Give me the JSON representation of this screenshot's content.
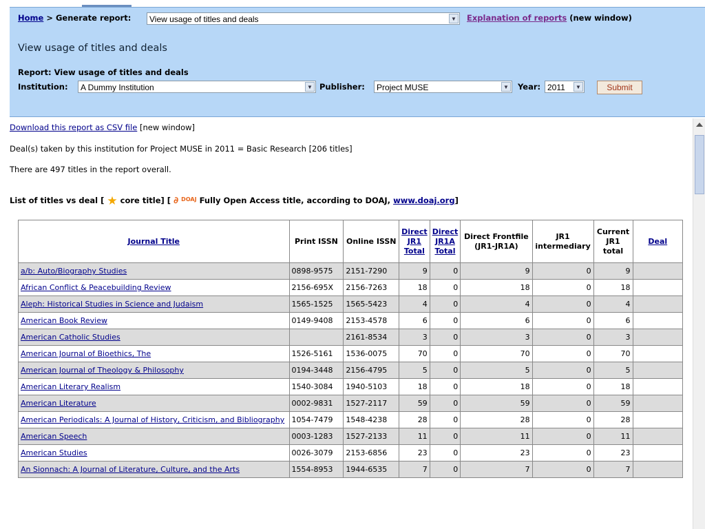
{
  "breadcrumb": {
    "home": "Home",
    "sep": ">",
    "label": "Generate report:",
    "report_select": "View usage of titles and deals",
    "explanation_link": "Explanation of reports",
    "explanation_suffix": "(new window)"
  },
  "panel": {
    "title": "View usage of titles and deals",
    "report_label": "Report:",
    "report_value": "View usage of titles and deals",
    "institution_label": "Institution:",
    "institution_value": "A Dummy Institution",
    "publisher_label": "Publisher:",
    "publisher_value": "Project MUSE",
    "year_label": "Year:",
    "year_value": "2011",
    "submit_label": "Submit"
  },
  "content": {
    "download_link": "Download this report as CSV file",
    "download_suffix": "[new window]",
    "deal_line": "Deal(s) taken by this institution for Project MUSE in 2011 = Basic Research [206 titles]",
    "count_line": "There are 497 titles in the report overall.",
    "list_head_pre": "List of titles vs deal [",
    "core_label": "core title] [",
    "doaj_badge": "DOAJ",
    "oa_label": "Fully Open Access title, according to DOAJ,",
    "doaj_link": "www.doaj.org",
    "list_head_post": "]"
  },
  "table": {
    "headers": {
      "title": "Journal Title",
      "print": "Print ISSN",
      "online": "Online ISSN",
      "jr1": "Direct JR1 Total",
      "jr1a": "Direct JR1A Total",
      "frontfile": "Direct Frontfile (JR1-JR1A)",
      "intermediary": "JR1 intermediary",
      "current": "Current JR1 total",
      "deal": "Deal"
    },
    "rows": [
      {
        "title": "a/b: Auto/Biography Studies",
        "print": "0898-9575",
        "online": "2151-7290",
        "jr1": "9",
        "jr1a": "0",
        "front": "9",
        "inter": "0",
        "cur": "9",
        "deal": ""
      },
      {
        "title": "African Conflict & Peacebuilding Review",
        "print": "2156-695X",
        "online": "2156-7263",
        "jr1": "18",
        "jr1a": "0",
        "front": "18",
        "inter": "0",
        "cur": "18",
        "deal": ""
      },
      {
        "title": "Aleph: Historical Studies in Science and Judaism",
        "print": "1565-1525",
        "online": "1565-5423",
        "jr1": "4",
        "jr1a": "0",
        "front": "4",
        "inter": "0",
        "cur": "4",
        "deal": ""
      },
      {
        "title": "American Book Review",
        "print": "0149-9408",
        "online": "2153-4578",
        "jr1": "6",
        "jr1a": "0",
        "front": "6",
        "inter": "0",
        "cur": "6",
        "deal": ""
      },
      {
        "title": "American Catholic Studies",
        "print": "",
        "online": "2161-8534",
        "jr1": "3",
        "jr1a": "0",
        "front": "3",
        "inter": "0",
        "cur": "3",
        "deal": ""
      },
      {
        "title": "American Journal of Bioethics, The",
        "print": "1526-5161",
        "online": "1536-0075",
        "jr1": "70",
        "jr1a": "0",
        "front": "70",
        "inter": "0",
        "cur": "70",
        "deal": ""
      },
      {
        "title": "American Journal of Theology & Philosophy",
        "print": "0194-3448",
        "online": "2156-4795",
        "jr1": "5",
        "jr1a": "0",
        "front": "5",
        "inter": "0",
        "cur": "5",
        "deal": ""
      },
      {
        "title": "American Literary Realism",
        "print": "1540-3084",
        "online": "1940-5103",
        "jr1": "18",
        "jr1a": "0",
        "front": "18",
        "inter": "0",
        "cur": "18",
        "deal": ""
      },
      {
        "title": "American Literature",
        "print": "0002-9831",
        "online": "1527-2117",
        "jr1": "59",
        "jr1a": "0",
        "front": "59",
        "inter": "0",
        "cur": "59",
        "deal": ""
      },
      {
        "title": "American Periodicals: A Journal of History, Criticism, and Bibliography",
        "print": "1054-7479",
        "online": "1548-4238",
        "jr1": "28",
        "jr1a": "0",
        "front": "28",
        "inter": "0",
        "cur": "28",
        "deal": ""
      },
      {
        "title": "American Speech",
        "print": "0003-1283",
        "online": "1527-2133",
        "jr1": "11",
        "jr1a": "0",
        "front": "11",
        "inter": "0",
        "cur": "11",
        "deal": ""
      },
      {
        "title": "American Studies",
        "print": "0026-3079",
        "online": "2153-6856",
        "jr1": "23",
        "jr1a": "0",
        "front": "23",
        "inter": "0",
        "cur": "23",
        "deal": ""
      },
      {
        "title": "An Sionnach: A Journal of Literature, Culture, and the Arts",
        "print": "1554-8953",
        "online": "1944-6535",
        "jr1": "7",
        "jr1a": "0",
        "front": "7",
        "inter": "0",
        "cur": "7",
        "deal": ""
      }
    ]
  }
}
